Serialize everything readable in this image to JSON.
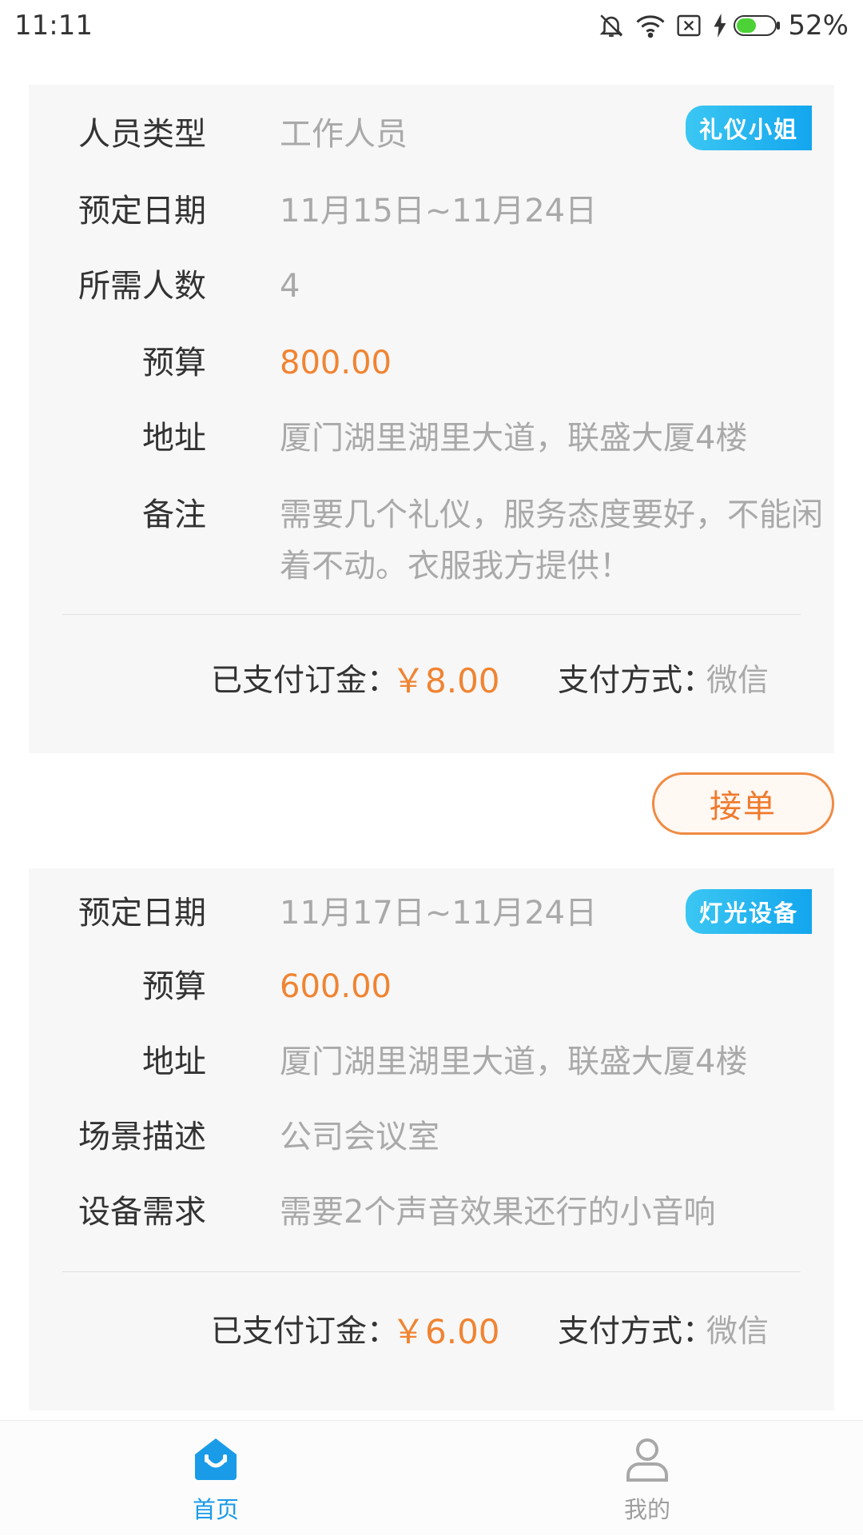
{
  "status_bar": {
    "time": "11:11",
    "battery_percent": "52%",
    "battery_level": 0.52,
    "icons": [
      "bell-off-icon",
      "wifi-icon",
      "sim-none-icon",
      "charging-icon",
      "battery-icon"
    ]
  },
  "orders": [
    {
      "tag": "礼仪小姐",
      "fields": [
        {
          "label": "人员类型",
          "value": "工作人员"
        },
        {
          "label": "预定日期",
          "value": "11月15日~11月24日"
        },
        {
          "label": "所需人数",
          "value": "4"
        },
        {
          "label": "预算",
          "value": "800.00"
        },
        {
          "label": "地址",
          "value": "厦门湖里湖里大道，联盛大厦4楼"
        },
        {
          "label": "备注",
          "value": "需要几个礼仪，服务态度要好，不能闲着不动。衣服我方提供！"
        }
      ],
      "deposit_label": "已支付订金：",
      "deposit_value": "￥8.00",
      "pay_method_label": "支付方式：",
      "pay_method_value": "微信",
      "accept_button": "接单"
    },
    {
      "tag": "灯光设备",
      "fields": [
        {
          "label": "预定日期",
          "value": "11月17日~11月24日"
        },
        {
          "label": "预算",
          "value": "600.00"
        },
        {
          "label": "地址",
          "value": "厦门湖里湖里大道，联盛大厦4楼"
        },
        {
          "label": "场景描述",
          "value": "公司会议室"
        },
        {
          "label": "设备需求",
          "value": "需要2个声音效果还行的小音响"
        }
      ],
      "deposit_label": "已支付订金：",
      "deposit_value": "￥6.00",
      "pay_method_label": "支付方式：",
      "pay_method_value": "微信"
    }
  ],
  "tabbar": {
    "items": [
      {
        "label": "首页",
        "icon": "home-icon",
        "active": true
      },
      {
        "label": "我的",
        "icon": "user-icon",
        "active": false
      }
    ]
  },
  "colors": {
    "accent": "#1a9be8",
    "price": "#f08432",
    "tag_gradient_start": "#3bc7f2",
    "tag_gradient_end": "#13a6ee"
  }
}
